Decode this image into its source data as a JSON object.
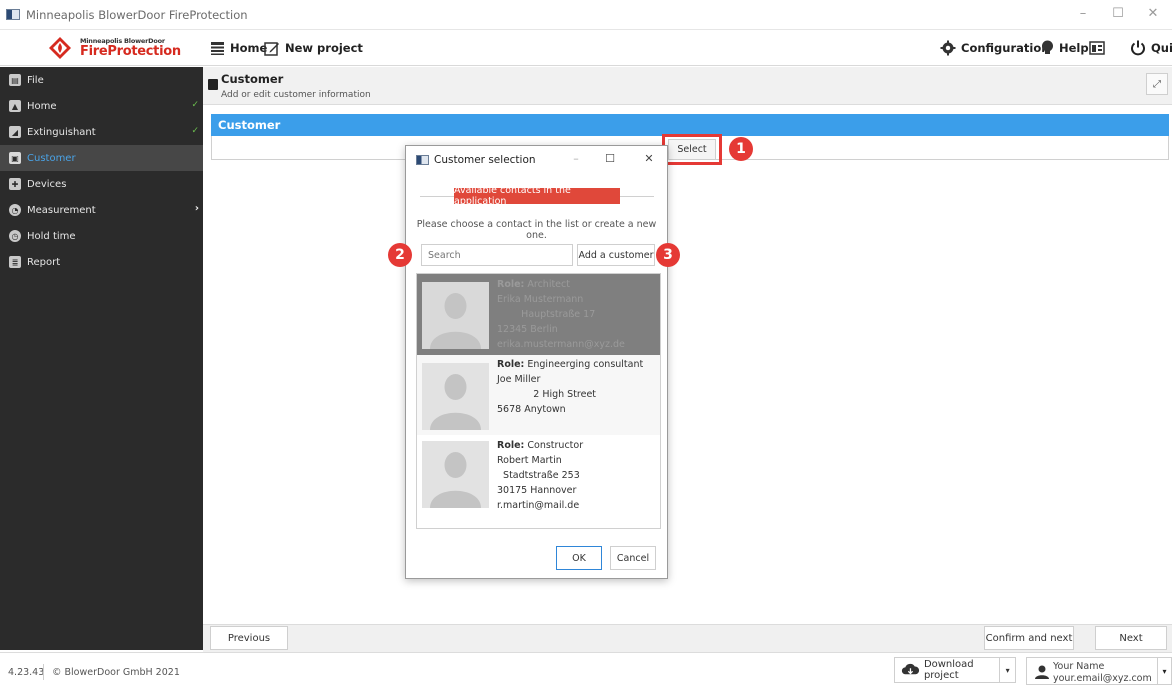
{
  "window": {
    "title": "Minneapolis BlowerDoor FireProtection",
    "minimize": "–",
    "maximize": "☐",
    "close": "✕"
  },
  "logo": {
    "small": "Minneapolis BlowerDoor",
    "big_red": "Fire",
    "big_dark": "Protection"
  },
  "toolbar": {
    "home": "Home",
    "new_project": "New project",
    "configuration": "Configuration",
    "help": "Help",
    "quit": "Quit"
  },
  "sidebar": {
    "items": [
      {
        "label": "File",
        "icon": "file-icon"
      },
      {
        "label": "Home",
        "icon": "home-icon",
        "done": "✓"
      },
      {
        "label": "Extinguishant",
        "icon": "extinguisher-icon",
        "done": "✓"
      },
      {
        "label": "Customer",
        "icon": "customer-icon"
      },
      {
        "label": "Devices",
        "icon": "devices-icon"
      },
      {
        "label": "Measurement",
        "icon": "measurement-icon",
        "arrow": "›"
      },
      {
        "label": "Hold time",
        "icon": "timer-icon"
      },
      {
        "label": "Report",
        "icon": "report-icon"
      }
    ]
  },
  "header": {
    "title": "Customer",
    "subtitle": "Add or edit customer information"
  },
  "panel": {
    "title": "Customer",
    "select": "Select"
  },
  "callouts": {
    "one": "1",
    "two": "2",
    "three": "3"
  },
  "dialog": {
    "title": "Customer selection",
    "banner": "Available contacts in the application",
    "instruction": "Please choose a contact in the list or create a new one.",
    "search_placeholder": "Search",
    "add": "Add a customer",
    "ok": "OK",
    "cancel": "Cancel",
    "contacts": [
      {
        "role_label": "Role:",
        "role": "Architect",
        "name": "Erika Mustermann",
        "street": "Hauptstraße 17",
        "city": "12345 Berlin",
        "email": "erika.mustermann@xyz.de"
      },
      {
        "role_label": "Role:",
        "role": "Engineerging consultant",
        "name": "Joe Miller",
        "street": "2 High Street",
        "city": "5678 Anytown",
        "email": ""
      },
      {
        "role_label": "Role:",
        "role": "Constructor",
        "name": "Robert Martin",
        "street": "Stadtstraße 253",
        "city": "30175 Hannover",
        "email": "r.martin@mail.de"
      }
    ]
  },
  "nav": {
    "previous": "Previous",
    "confirm_next": "Confirm and next",
    "next": "Next"
  },
  "status": {
    "version": "4.23.43",
    "copyright": "© BlowerDoor GmbH 2021",
    "download": "Download project",
    "user_name": "Your Name",
    "user_email": "your.email@xyz.com"
  },
  "colors": {
    "accent_blue": "#3b9eea",
    "red": "#e53935",
    "sidebar": "#2b2b2b"
  }
}
